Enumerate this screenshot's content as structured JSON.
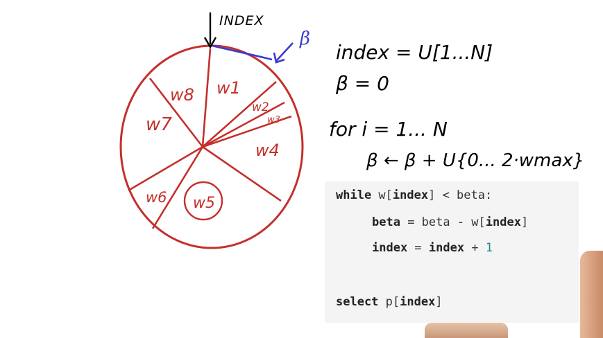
{
  "wheel": {
    "index_label": "INDEX",
    "beta_label": "β",
    "segments": [
      "w1",
      "w2",
      "w3",
      "w4",
      "w5",
      "w6",
      "w7",
      "w8"
    ],
    "stroke_color": "#c4302b",
    "arrow_color": "#3a3ad0"
  },
  "pseudo": {
    "line1": "index = U[1...N]",
    "line2": "β = 0",
    "line3": "for i = 1... N",
    "line4": "β ← β + U{0... 2·wmax}"
  },
  "code": {
    "line1_kw1": "while",
    "line1_a": " w[",
    "line1_kw2": "index",
    "line1_b": "] < beta:",
    "line2_kw": "beta",
    "line2_a": " = beta - w[",
    "line2_kw2": "index",
    "line2_b": "]",
    "line3_kw": "index",
    "line3_a": " = ",
    "line3_kw2": "index",
    "line3_b": " + ",
    "line3_num": "1",
    "line5_kw": "select",
    "line5_a": " p[",
    "line5_kw2": "index",
    "line5_b": "]"
  }
}
